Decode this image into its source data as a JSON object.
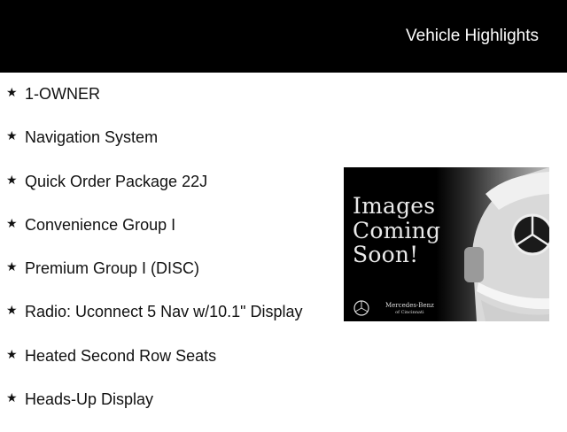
{
  "header": {
    "title": "Vehicle Highlights"
  },
  "highlights": [
    "1-OWNER",
    "Navigation System",
    "Quick Order Package 22J",
    "Convenience Group I",
    "Premium Group I (DISC)",
    "Radio: Uconnect 5 Nav w/10.1\" Display",
    "Heated Second Row Seats",
    "Heads-Up Display"
  ],
  "bullet_glyph": "★",
  "promo_image": {
    "lines": [
      "Images",
      "Coming",
      "Soon!"
    ],
    "brand": "Mercedes-Benz",
    "brand_sub": "of Cincinnati",
    "icon": "mercedes-star-logo"
  },
  "colors": {
    "header_bg": "#000000",
    "header_text": "#ffffff"
  }
}
